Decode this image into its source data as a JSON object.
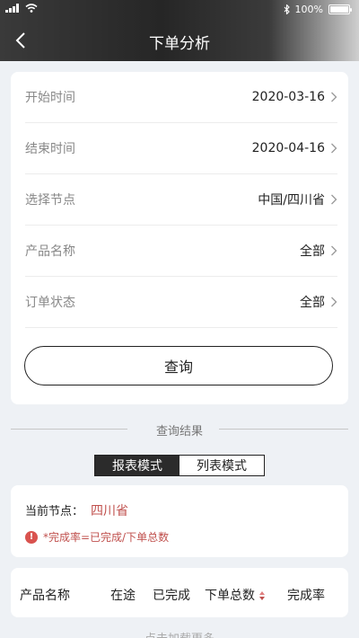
{
  "status_bar": {
    "battery": "100%"
  },
  "header": {
    "title": "下单分析"
  },
  "form": {
    "rows": [
      {
        "label": "开始时间",
        "value": "2020-03-16"
      },
      {
        "label": "结束时间",
        "value": "2020-04-16"
      },
      {
        "label": "选择节点",
        "value": "中国/四川省"
      },
      {
        "label": "产品名称",
        "value": "全部"
      },
      {
        "label": "订单状态",
        "value": "全部"
      }
    ],
    "query_label": "查询"
  },
  "results": {
    "divider_label": "查询结果",
    "modes": [
      "报表模式",
      "列表模式"
    ],
    "active_mode": "报表模式"
  },
  "node_info": {
    "label": "当前节点：",
    "value": "四川省",
    "note": "*完成率=已完成/下单总数"
  },
  "table": {
    "columns": [
      "产品名称",
      "在途",
      "已完成",
      "下单总数",
      "完成率"
    ]
  },
  "load_more": "点击加载更多",
  "colors": {
    "accent_red": "#c0504d",
    "header_dark": "#262626"
  }
}
